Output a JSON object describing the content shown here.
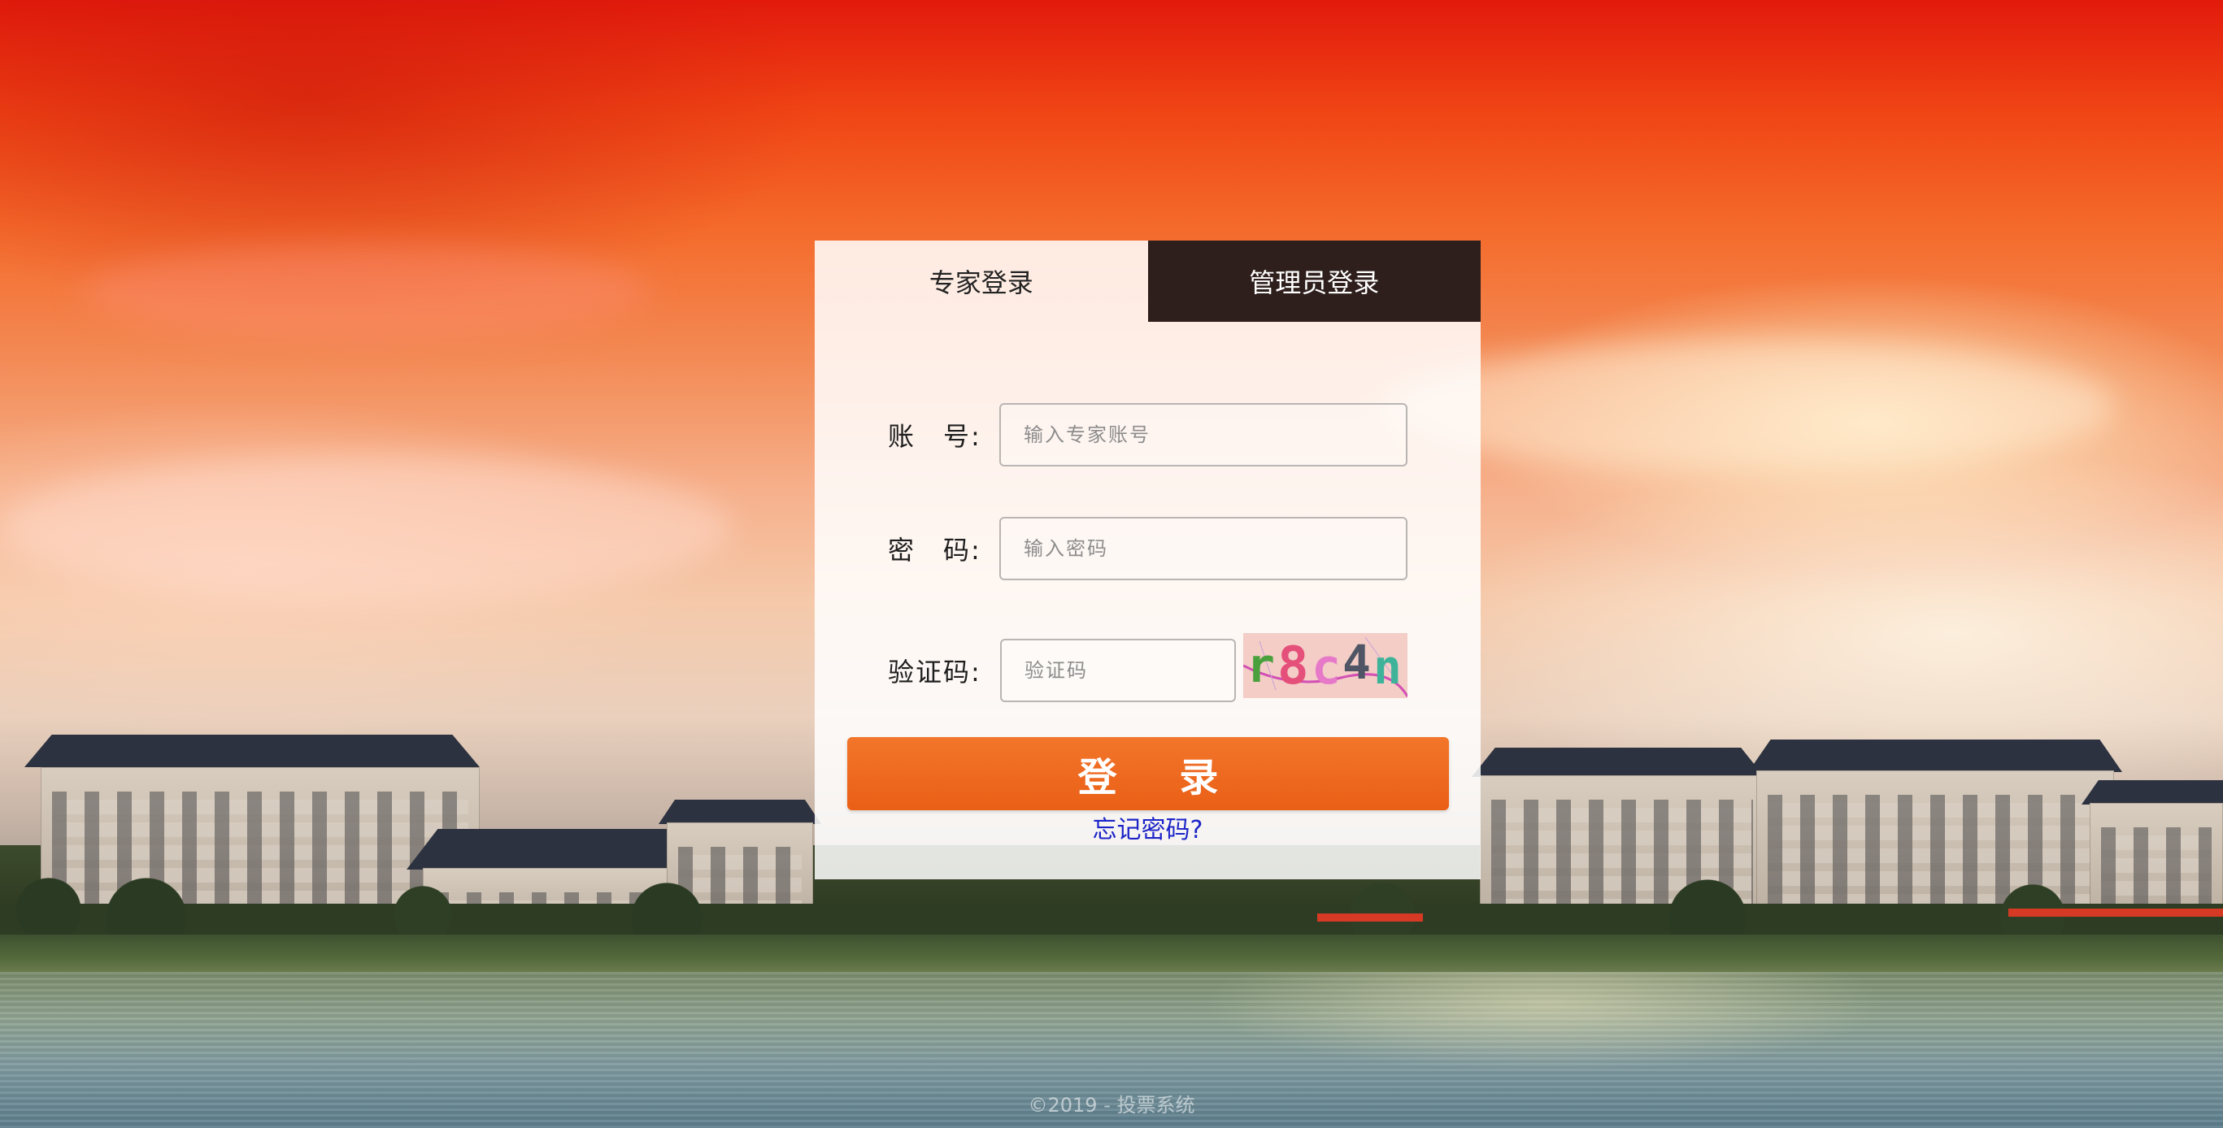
{
  "tabs": [
    {
      "label": "专家登录",
      "active": true
    },
    {
      "label": "管理员登录",
      "active": false
    }
  ],
  "form": {
    "account": {
      "label": "账　号:",
      "placeholder": "输入专家账号",
      "value": ""
    },
    "password": {
      "label": "密　码:",
      "placeholder": "输入密码",
      "value": ""
    },
    "captcha": {
      "label": "验证码:",
      "placeholder": "验证码",
      "value": "",
      "image_text": "r8c4n"
    }
  },
  "login_button": "登 录",
  "forgot_link": "忘记密码?",
  "footer": "©2019 - 投票系统",
  "colors": {
    "accent": "#ea5f16",
    "inactive_tab": "#2e1f1c",
    "link": "#1c24c8"
  }
}
